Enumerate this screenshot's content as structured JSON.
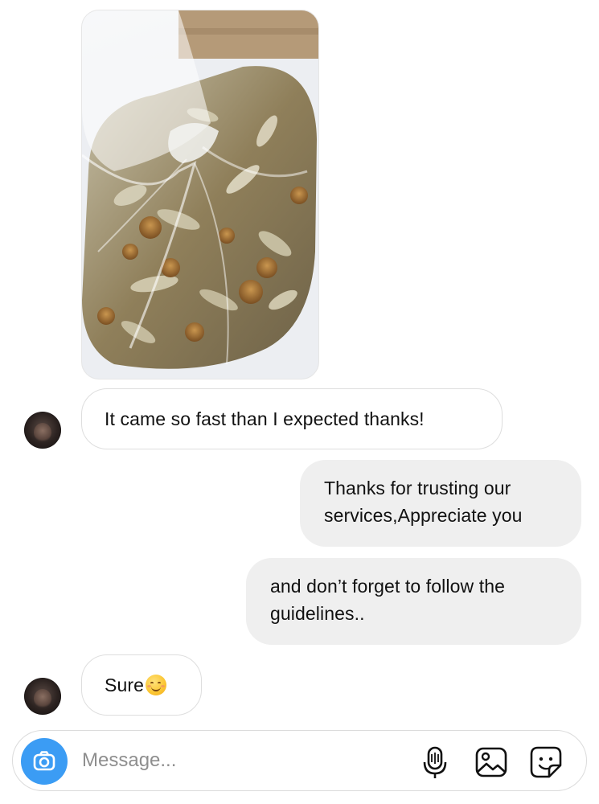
{
  "conversation": {
    "messages": [
      {
        "sender": "contact",
        "type": "image",
        "description": "shared photo"
      },
      {
        "sender": "contact",
        "type": "text",
        "text": "It came so fast than I expected thanks!"
      },
      {
        "sender": "me",
        "type": "text",
        "lines": [
          "Thanks for trusting our",
          "services,Appreciate you"
        ]
      },
      {
        "sender": "me",
        "type": "text",
        "lines": [
          "and don’t forget to follow the",
          "guidelines.."
        ]
      },
      {
        "sender": "contact",
        "type": "text",
        "text": "Sure",
        "emoji": "smiling-face-emoji"
      }
    ]
  },
  "composer": {
    "placeholder": "Message...",
    "icons": [
      "camera-icon",
      "microphone-icon",
      "gallery-icon",
      "sticker-icon"
    ],
    "camera_color": "#3b9cf4"
  },
  "colors": {
    "incoming_bubble_border": "#dedede",
    "outgoing_bubble": "#efefef"
  }
}
